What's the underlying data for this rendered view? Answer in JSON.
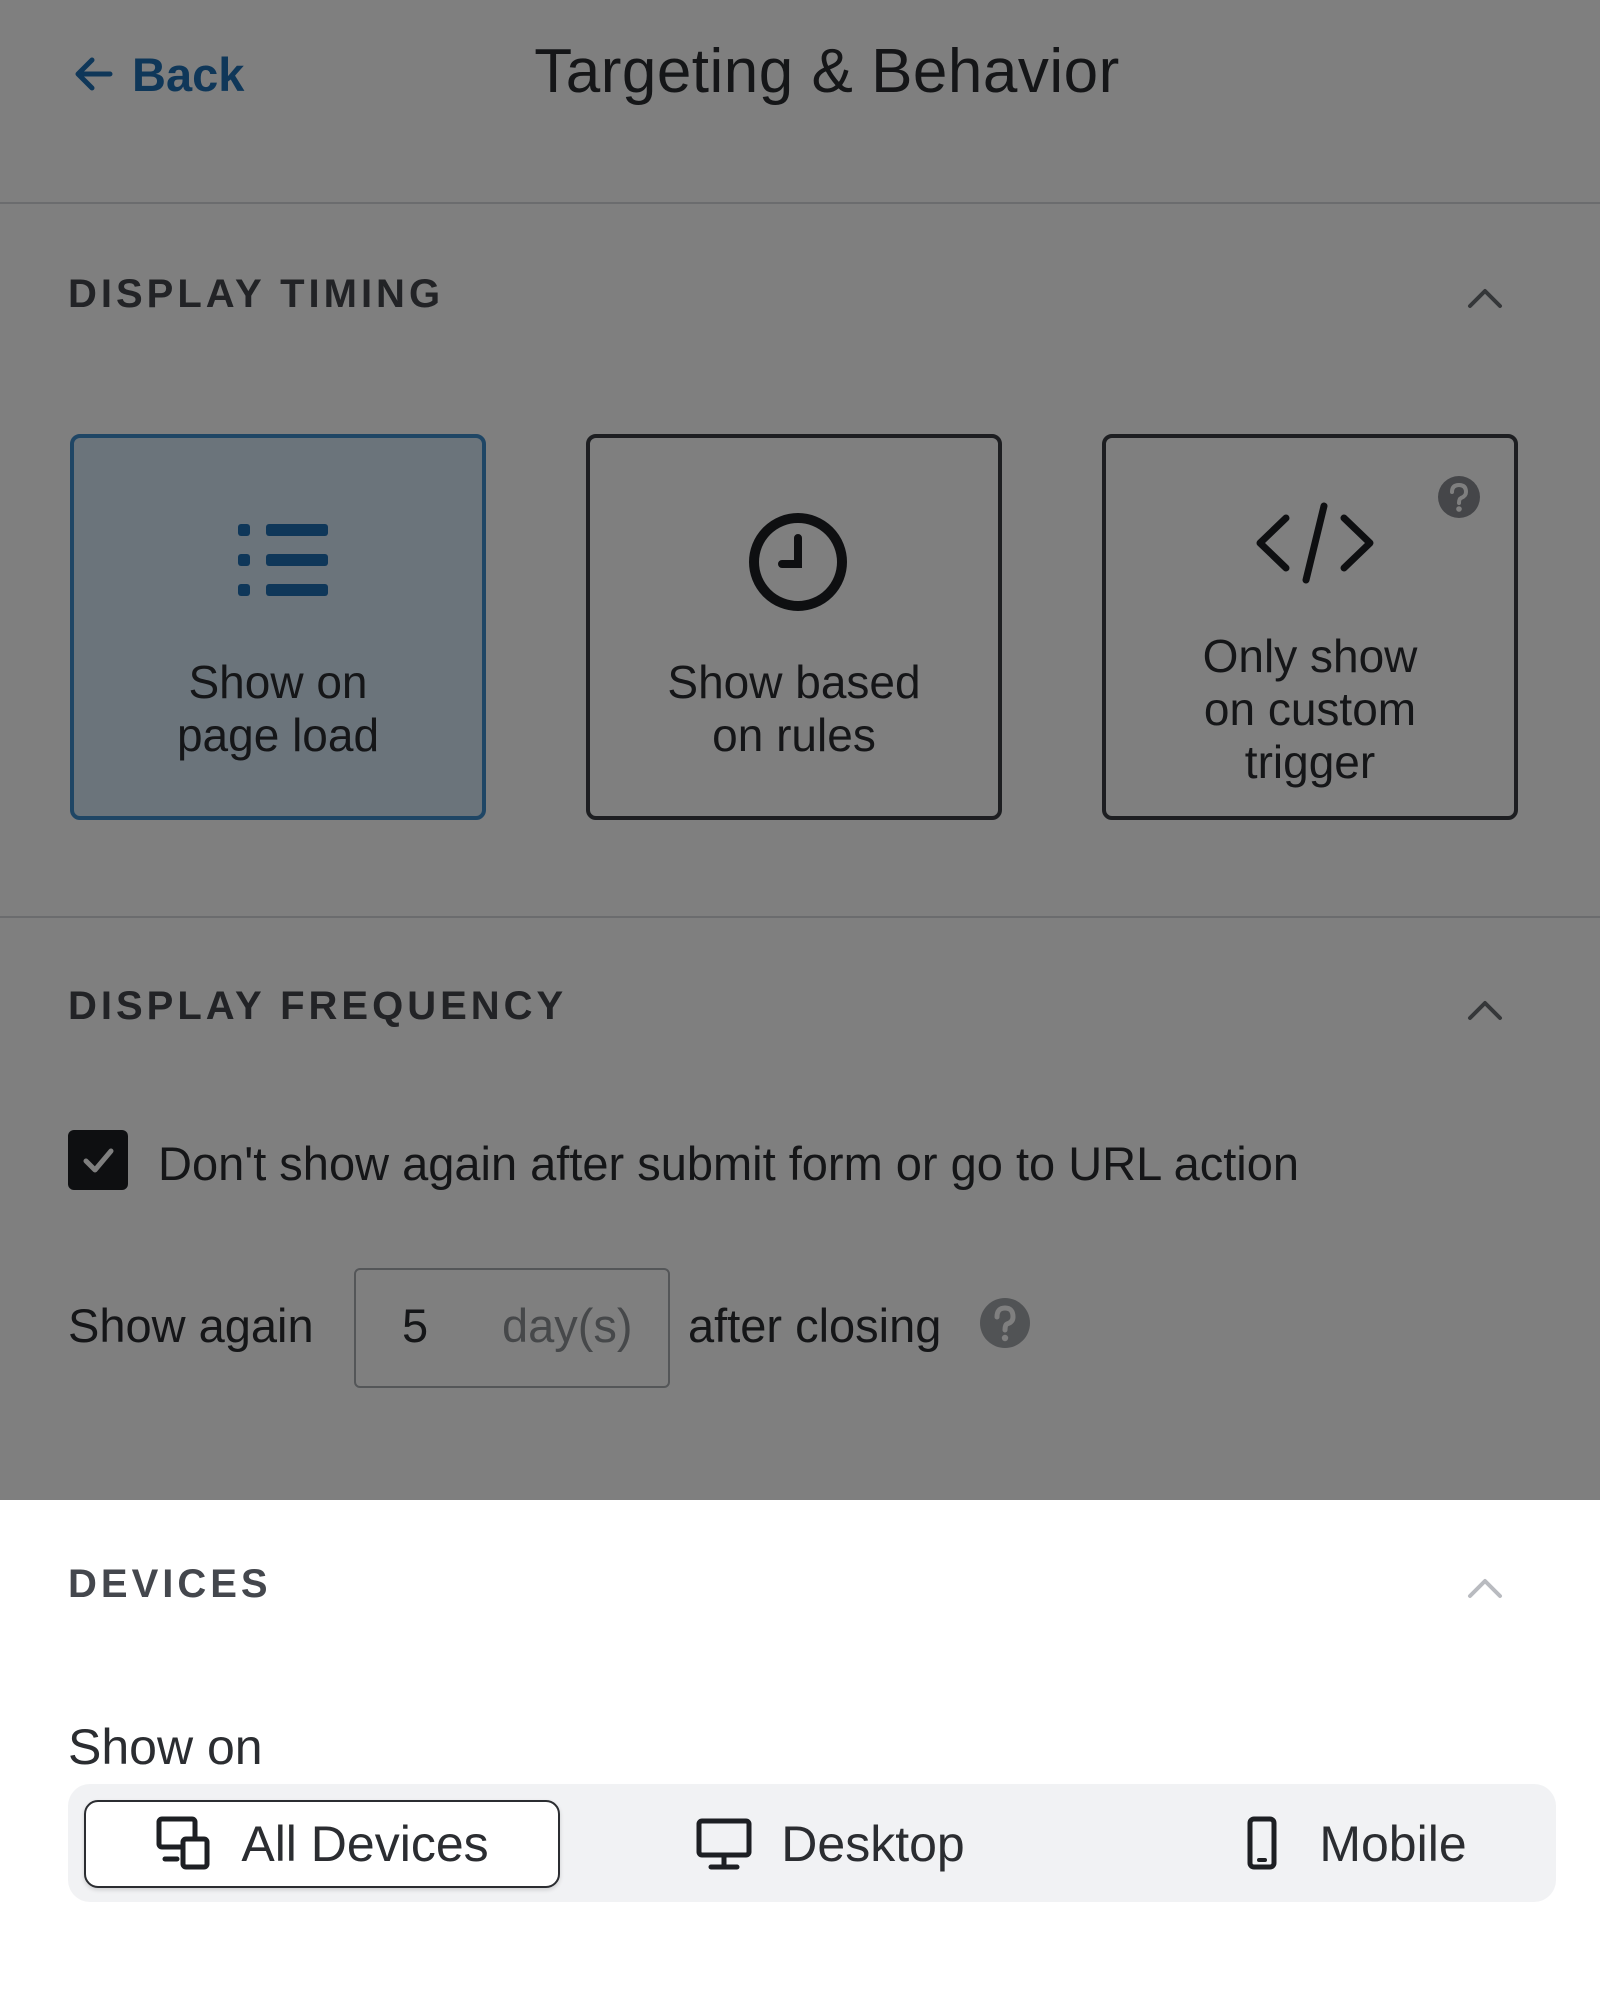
{
  "header": {
    "back_label": "Back",
    "title": "Targeting & Behavior"
  },
  "display_timing": {
    "title": "DISPLAY TIMING",
    "options": [
      {
        "label_line1": "Show on",
        "label_line2": "page load",
        "icon": "list-icon",
        "selected": true
      },
      {
        "label_line1": "Show based",
        "label_line2": "on rules",
        "icon": "clock-icon",
        "selected": false
      },
      {
        "label_line1": "Only show",
        "label_line2": "on custom",
        "label_line3": "trigger",
        "icon": "code-icon",
        "selected": false
      }
    ]
  },
  "display_frequency": {
    "title": "DISPLAY FREQUENCY",
    "dont_show_again_label": "Don't show again after submit form or go to URL action",
    "dont_show_again_checked": true,
    "show_again_prefix": "Show again",
    "show_again_value": "5",
    "show_again_unit": "day(s)",
    "show_again_suffix": "after closing"
  },
  "devices": {
    "title": "DEVICES",
    "show_on_label": "Show on",
    "options": [
      {
        "label": "All Devices",
        "icon": "all-devices-icon",
        "active": true
      },
      {
        "label": "Desktop",
        "icon": "desktop-icon",
        "active": false
      },
      {
        "label": "Mobile",
        "icon": "mobile-icon",
        "active": false
      }
    ]
  },
  "colors": {
    "accent": "#1f6fb3",
    "selected_card_bg": "#d7e8f7",
    "overlay": "rgba(0,0,0,0.5)"
  }
}
